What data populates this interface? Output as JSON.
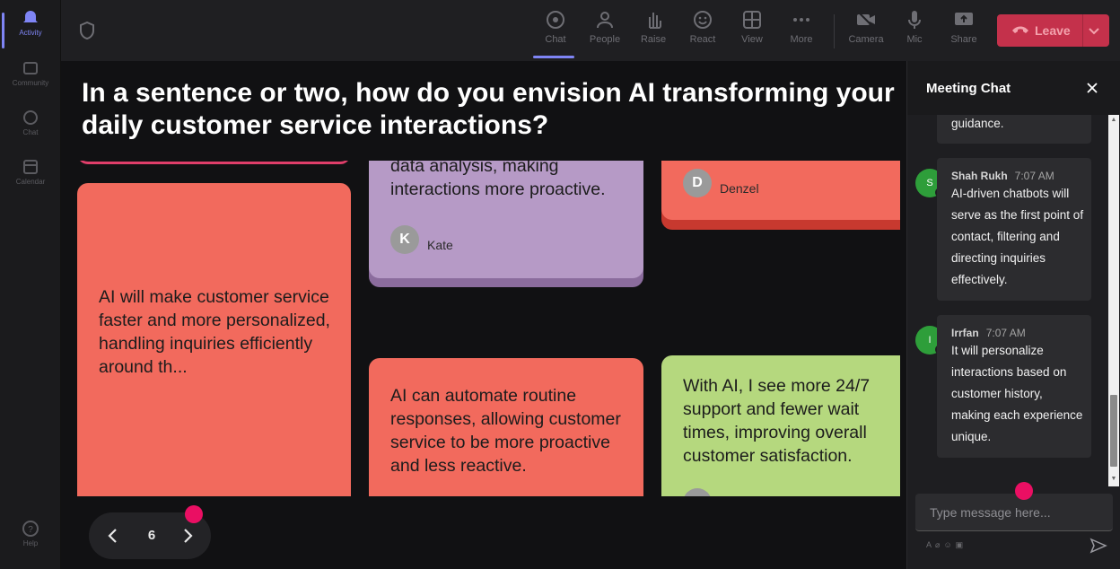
{
  "rail": {
    "items": [
      {
        "label": "Activity",
        "icon": "bell-icon",
        "active": true
      },
      {
        "label": "Community",
        "icon": "community-icon"
      },
      {
        "label": "Chat",
        "icon": "chat-icon"
      },
      {
        "label": "Calendar",
        "icon": "calendar-icon"
      },
      {
        "label": "Help",
        "icon": "help-icon"
      }
    ]
  },
  "toolbar": {
    "buttons": [
      {
        "label": "Chat",
        "icon": "chat-icon",
        "active": true
      },
      {
        "label": "People",
        "icon": "people-icon"
      },
      {
        "label": "Raise",
        "icon": "raise-hand-icon"
      },
      {
        "label": "React",
        "icon": "react-icon"
      },
      {
        "label": "View",
        "icon": "view-grid-icon"
      },
      {
        "label": "More",
        "icon": "more-icon"
      },
      {
        "label": "Camera",
        "icon": "camera-off-icon"
      },
      {
        "label": "Mic",
        "icon": "mic-icon"
      },
      {
        "label": "Share",
        "icon": "share-icon"
      }
    ],
    "leave_label": "Leave",
    "leave_color": "#c4314b"
  },
  "question": {
    "line1": "In a sentence or two, how do you envision AI transforming your",
    "line2": "daily customer service interactions?"
  },
  "cards": [
    {
      "text_line1": "data analysis, making",
      "text_line2": "interactions more proactive.",
      "author": "Kate",
      "initial": "K",
      "color": "#b69ac6"
    },
    {
      "author": "Denzel",
      "initial": "D",
      "color": "#f26a5d"
    },
    {
      "text": "AI will make customer service faster and more personalized, handling inquiries efficiently around th...",
      "color": "#f26a5d"
    },
    {
      "text": "AI can automate routine responses, allowing customer service to be more proactive and less reactive.",
      "color": "#f26a5d"
    },
    {
      "text": "With AI, I see more 24/7 support and fewer wait times, improving overall customer satisfaction.",
      "color": "#b5d87e"
    }
  ],
  "pager": {
    "page": "6"
  },
  "chat": {
    "title": "Meeting Chat",
    "messages": [
      {
        "text": "guidance."
      },
      {
        "author": "Shah Rukh",
        "time": "7:07 AM",
        "initial": "S",
        "text": "AI-driven chatbots will serve as the first point of contact, filtering and directing inquiries effectively."
      },
      {
        "author": "Irrfan",
        "time": "7:07 AM",
        "initial": "I",
        "text": "It will personalize interactions based on customer history, making each experience unique."
      }
    ],
    "input_placeholder": "Type message here..."
  }
}
